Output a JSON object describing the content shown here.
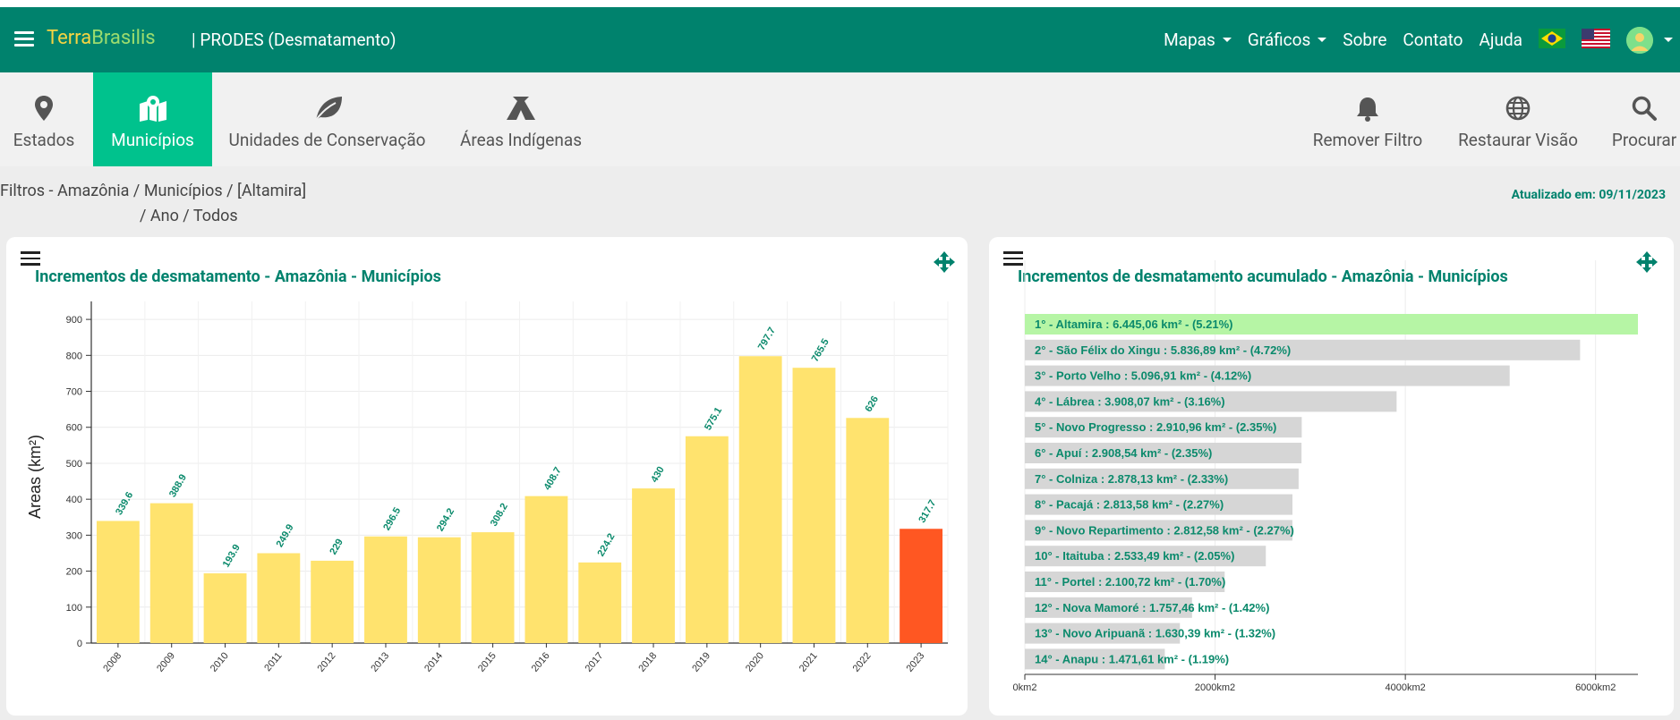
{
  "nav": {
    "brand_part1": "Terra",
    "brand_part2": "Brasilis",
    "subtitle": "| PRODES (Desmatamento)",
    "links": {
      "mapas": "Mapas",
      "graficos": "Gráficos",
      "sobre": "Sobre",
      "contato": "Contato",
      "ajuda": "Ajuda"
    }
  },
  "toolbar": {
    "estados": "Estados",
    "municipios": "Municípios",
    "unidades": "Unidades de Conservação",
    "areas": "Áreas Indígenas",
    "remover": "Remover Filtro",
    "restaurar": "Restaurar Visão",
    "procurar": "Procurar"
  },
  "filters": {
    "line1": "Filtros - Amazônia / Municípios / [Altamira]",
    "line2": "/ Ano / Todos"
  },
  "updated": "Atualizado em: 09/11/2023",
  "colors": {
    "navbar": "#00826d",
    "active_tab": "#00c28d",
    "bar": "#ffe36e",
    "bar_highlight": "#ff5722",
    "hbar": "#d6d6d6",
    "hbar_highlight": "#b6f5a5"
  },
  "chart_data": [
    {
      "type": "bar",
      "title": "Incrementos de desmatamento - Amazônia - Municípios",
      "ylabel": "Areas (km²)",
      "ylim": [
        0,
        950
      ],
      "yticks": [
        0,
        100,
        200,
        300,
        400,
        500,
        600,
        700,
        800,
        900
      ],
      "grid": true,
      "categories": [
        "2008",
        "2009",
        "2010",
        "2011",
        "2012",
        "2013",
        "2014",
        "2015",
        "2016",
        "2017",
        "2018",
        "2019",
        "2020",
        "2021",
        "2022",
        "2023"
      ],
      "values": [
        339.6,
        388.9,
        193.9,
        249.9,
        229,
        296.5,
        294.2,
        308.2,
        408.7,
        224.2,
        430,
        575.1,
        797.7,
        765.5,
        626,
        317.7
      ],
      "highlight_index": 15
    },
    {
      "type": "bar",
      "orientation": "horizontal",
      "title": "Incrementos de desmatamento acumulado - Amazônia - Municípios",
      "xlim": [
        0,
        6445.06
      ],
      "xticks": [
        0,
        2000,
        4000,
        6000
      ],
      "xtick_labels": [
        "0km2",
        "2000km2",
        "4000km2",
        "6000km2"
      ],
      "grid": true,
      "labels": [
        "1° - Altamira : 6.445,06 km² - (5.21%)",
        "2° - São Félix do Xingu : 5.836,89 km² - (4.72%)",
        "3° - Porto Velho : 5.096,91 km² - (4.12%)",
        "4° - Lábrea : 3.908,07 km² - (3.16%)",
        "5° - Novo Progresso : 2.910,96 km² - (2.35%)",
        "6° - Apuí : 2.908,54 km² - (2.35%)",
        "7° - Colniza : 2.878,13 km² - (2.33%)",
        "8° - Pacajá : 2.813,58 km² - (2.27%)",
        "9° - Novo Repartimento : 2.812,58 km² - (2.27%)",
        "10° - Itaituba : 2.533,49 km² - (2.05%)",
        "11° - Portel : 2.100,72 km² - (1.70%)",
        "12° - Nova Mamoré : 1.757,46 km² - (1.42%)",
        "13° - Novo Aripuanã : 1.630,39 km² - (1.32%)",
        "14° - Anapu : 1.471,61 km² - (1.19%)"
      ],
      "values": [
        6445.06,
        5836.89,
        5096.91,
        3908.07,
        2910.96,
        2908.54,
        2878.13,
        2813.58,
        2812.58,
        2533.49,
        2100.72,
        1757.46,
        1630.39,
        1471.61
      ],
      "highlight_index": 0
    }
  ]
}
